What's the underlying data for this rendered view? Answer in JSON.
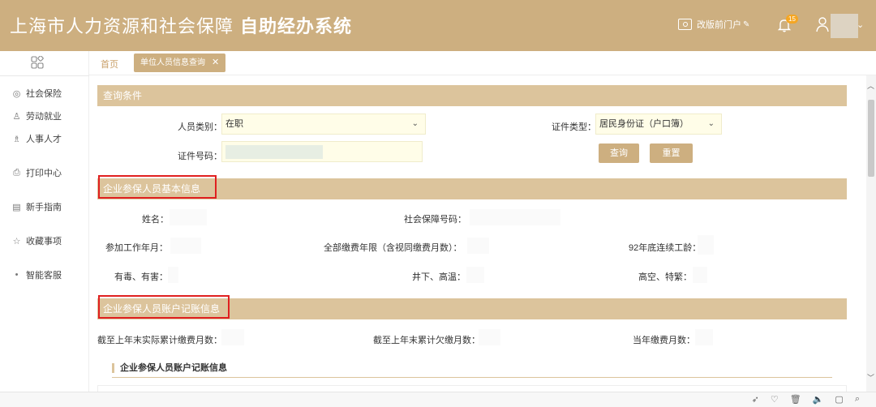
{
  "header": {
    "title_normal": "上海市人力资源和社会保障",
    "title_bold": "自助经办系统",
    "portal_label": "改版前门户",
    "bell_badge": "15",
    "chevron": "⌄"
  },
  "sidebar": {
    "items": [
      {
        "icon": "social-security-icon",
        "label": "社会保险"
      },
      {
        "icon": "employment-icon",
        "label": "劳动就业"
      },
      {
        "icon": "talent-icon",
        "label": "人事人才"
      },
      {
        "icon": "printer-icon",
        "label": "打印中心"
      },
      {
        "icon": "guide-icon",
        "label": "新手指南"
      },
      {
        "icon": "star-icon",
        "label": "收藏事项"
      },
      {
        "icon": "dot-icon",
        "label": "智能客服"
      }
    ]
  },
  "tabs": {
    "home": "首页",
    "active": "单位人员信息查询",
    "close": "✕"
  },
  "query": {
    "section_title": "查询条件",
    "person_type_label": "人员类别：",
    "person_type_value": "在职",
    "id_type_label": "证件类型：",
    "id_type_value": "居民身份证（户口簿）",
    "id_number_label": "证件号码：",
    "search_button": "查询",
    "reset_button": "重置"
  },
  "basic_info": {
    "section_title": "企业参保人员基本信息",
    "name_label": "姓名：",
    "ssn_label": "社会保障号码：",
    "work_start_label": "参加工作年月：",
    "total_years_label": "全部缴费年限（含视同缴费月数）：",
    "continuous_label": "92年底连续工龄：",
    "toxic_label": "有毒、有害：",
    "underground_label": "井下、高温：",
    "high_altitude_label": "高空、特繁："
  },
  "account_info": {
    "section_title": "企业参保人员账户记账信息",
    "actual_months_label": "截至上年末实际累计缴费月数：",
    "arrears_months_label": "截至上年末累计欠缴月数：",
    "current_months_label": "当年缴费月数：",
    "subsection_title": "企业参保人员账户记账信息"
  },
  "colors": {
    "brand": "#cdaf80",
    "section_bar": "#dcc49c",
    "highlight_border": "#e02020",
    "field_bg": "#fffde8"
  }
}
